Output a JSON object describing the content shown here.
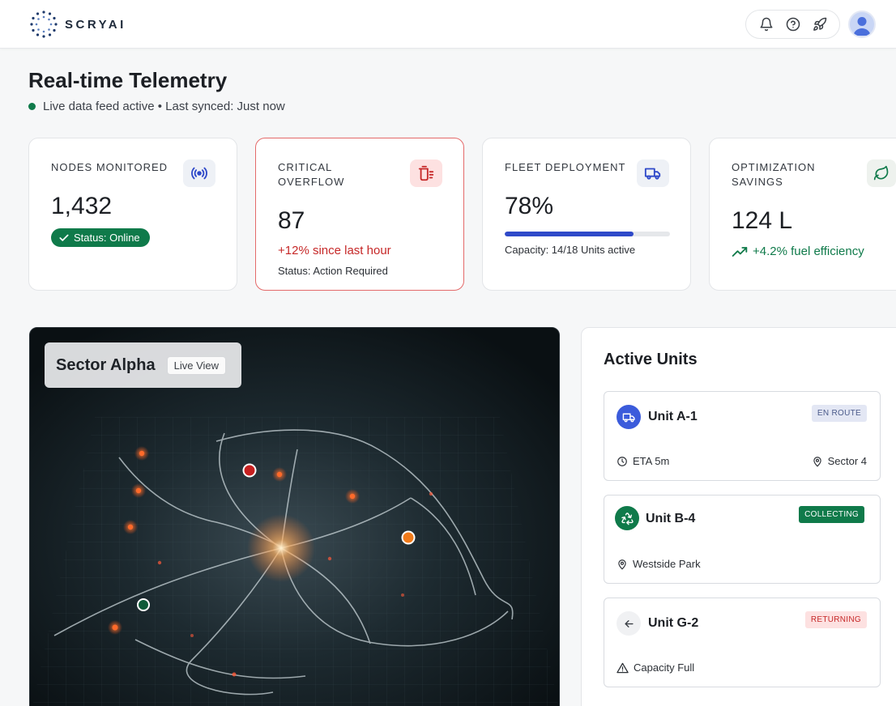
{
  "header": {
    "logo_text": "SCRYAI",
    "icons": [
      "bell-icon",
      "help-icon",
      "rocket-icon"
    ],
    "avatar": "user-avatar"
  },
  "page": {
    "title": "Real-time Telemetry",
    "status": "Live data feed active • Last synced: Just now"
  },
  "kpis": {
    "nodes": {
      "label": "Nodes Monitored",
      "value": "1,432",
      "badge": "Status: Online",
      "icon": "signal-icon"
    },
    "overflow": {
      "label": "Critical Overflow",
      "value": "87",
      "trend": "+12% since last hour",
      "sub": "Status: Action Required",
      "icon": "overflow-bin-icon"
    },
    "fleet": {
      "label": "Fleet Deployment",
      "value": "78%",
      "progress": 0.78,
      "sub": "Capacity: 14/18 Units active",
      "icon": "truck-icon"
    },
    "savings": {
      "label": "Optimization Savings",
      "value": "124 L",
      "trend": "+4.2% fuel efficiency",
      "icon": "leaf-icon"
    }
  },
  "map": {
    "title": "Sector Alpha",
    "badge": "Live View"
  },
  "units_panel": {
    "title": "Active Units",
    "units": [
      {
        "name": "Unit A-1",
        "status": "EN ROUTE",
        "meta_left": "ETA 5m",
        "meta_right": "Sector 4",
        "icon": "truck-icon",
        "color": "#3b5bdb",
        "badge_bg": "#e3e7f4",
        "badge_fg": "#4a5a8a"
      },
      {
        "name": "Unit B-4",
        "status": "COLLECTING",
        "meta_left": "Westside Park",
        "icon": "recycle-icon",
        "color": "#0f7a4a",
        "badge_bg": "#0f7a4a",
        "badge_fg": "#ffffff"
      },
      {
        "name": "Unit G-2",
        "status": "RETURNING",
        "meta_left": "Capacity Full",
        "icon": "return-arrow-icon",
        "color": "#f0f1f3",
        "badge_bg": "#fde1e1",
        "badge_fg": "#c62828"
      }
    ]
  }
}
